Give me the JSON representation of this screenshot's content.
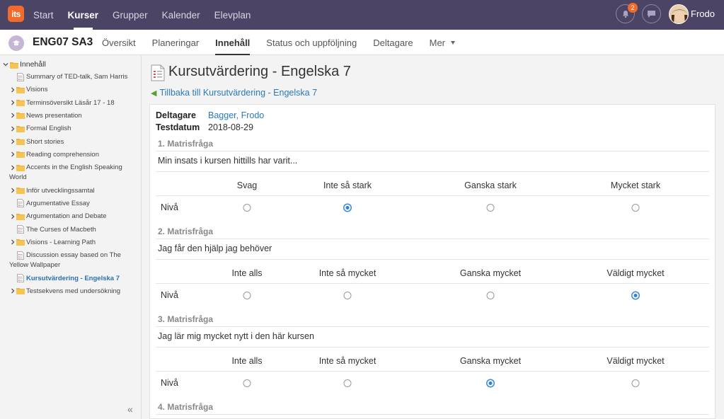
{
  "logo": {
    "text": "its"
  },
  "topnav": [
    {
      "label": "Start"
    },
    {
      "label": "Kurser",
      "active": true
    },
    {
      "label": "Grupper"
    },
    {
      "label": "Kalender"
    },
    {
      "label": "Elevplan"
    }
  ],
  "notifications": {
    "count": "2"
  },
  "user": {
    "name": "Frodo"
  },
  "course": {
    "code": "ENG07 SA3",
    "tabs": [
      {
        "label": "Översikt"
      },
      {
        "label": "Planeringar"
      },
      {
        "label": "Innehåll",
        "active": true
      },
      {
        "label": "Status och uppföljning"
      },
      {
        "label": "Deltagare"
      },
      {
        "label": "Mer"
      }
    ]
  },
  "sidebar": {
    "root": "Innehåll",
    "items": [
      {
        "label": "Summary of TED-talk, Sam Harris",
        "type": "doc"
      },
      {
        "label": "Visions",
        "type": "folder"
      },
      {
        "label": "Terminsöversikt Läsår 17 - 18",
        "type": "folder"
      },
      {
        "label": "News presentation",
        "type": "folder"
      },
      {
        "label": "Formal English",
        "type": "folder"
      },
      {
        "label": "Short stories",
        "type": "folder"
      },
      {
        "label": "Reading comprehension",
        "type": "folder"
      },
      {
        "label": "Accents in the English Speaking",
        "label2": "World",
        "type": "folder"
      },
      {
        "label": "Inför utvecklingssamtal",
        "type": "folder"
      },
      {
        "label": "Argumentative Essay",
        "type": "doc"
      },
      {
        "label": "Argumentation and Debate",
        "type": "folder"
      },
      {
        "label": "The Curses of Macbeth",
        "type": "doc"
      },
      {
        "label": "Visions - Learning Path",
        "type": "folder"
      },
      {
        "label": "Discussion essay based on The",
        "label2": "Yellow Wallpaper",
        "type": "doc"
      },
      {
        "label": "Kursutvärdering - Engelska 7",
        "type": "doc",
        "selected": true
      },
      {
        "label": "Testsekvens med undersökning",
        "type": "folder"
      }
    ],
    "collapse_icon": "double-chevron-left-icon"
  },
  "page": {
    "title": "Kursutvärdering - Engelska 7",
    "back_link": "Tillbaka till Kursutvärdering - Engelska 7",
    "participant_label": "Deltagare",
    "participant_value": "Bagger, Frodo",
    "testdate_label": "Testdatum",
    "testdate_value": "2018-08-29"
  },
  "questions": [
    {
      "heading": "1. Matrisfråga",
      "text": "Min insats i kursen hittills har varit...",
      "columns": [
        "Svag",
        "Inte så stark",
        "Ganska stark",
        "Mycket stark"
      ],
      "row_label": "Nivå",
      "selected": 1
    },
    {
      "heading": "2. Matrisfråga",
      "text": "Jag får den hjälp jag behöver",
      "columns": [
        "Inte alls",
        "Inte så mycket",
        "Ganska mycket",
        "Väldigt mycket"
      ],
      "row_label": "Nivå",
      "selected": 3
    },
    {
      "heading": "3. Matrisfråga",
      "text": "Jag lär mig mycket nytt i den här kursen",
      "columns": [
        "Inte alls",
        "Inte så mycket",
        "Ganska mycket",
        "Väldigt mycket"
      ],
      "row_label": "Nivå",
      "selected": 2
    },
    {
      "heading": "4. Matrisfråga"
    }
  ],
  "colors": {
    "topbar": "#4b4464",
    "accent": "#2a7ab8",
    "logo": "#f26b2a"
  }
}
